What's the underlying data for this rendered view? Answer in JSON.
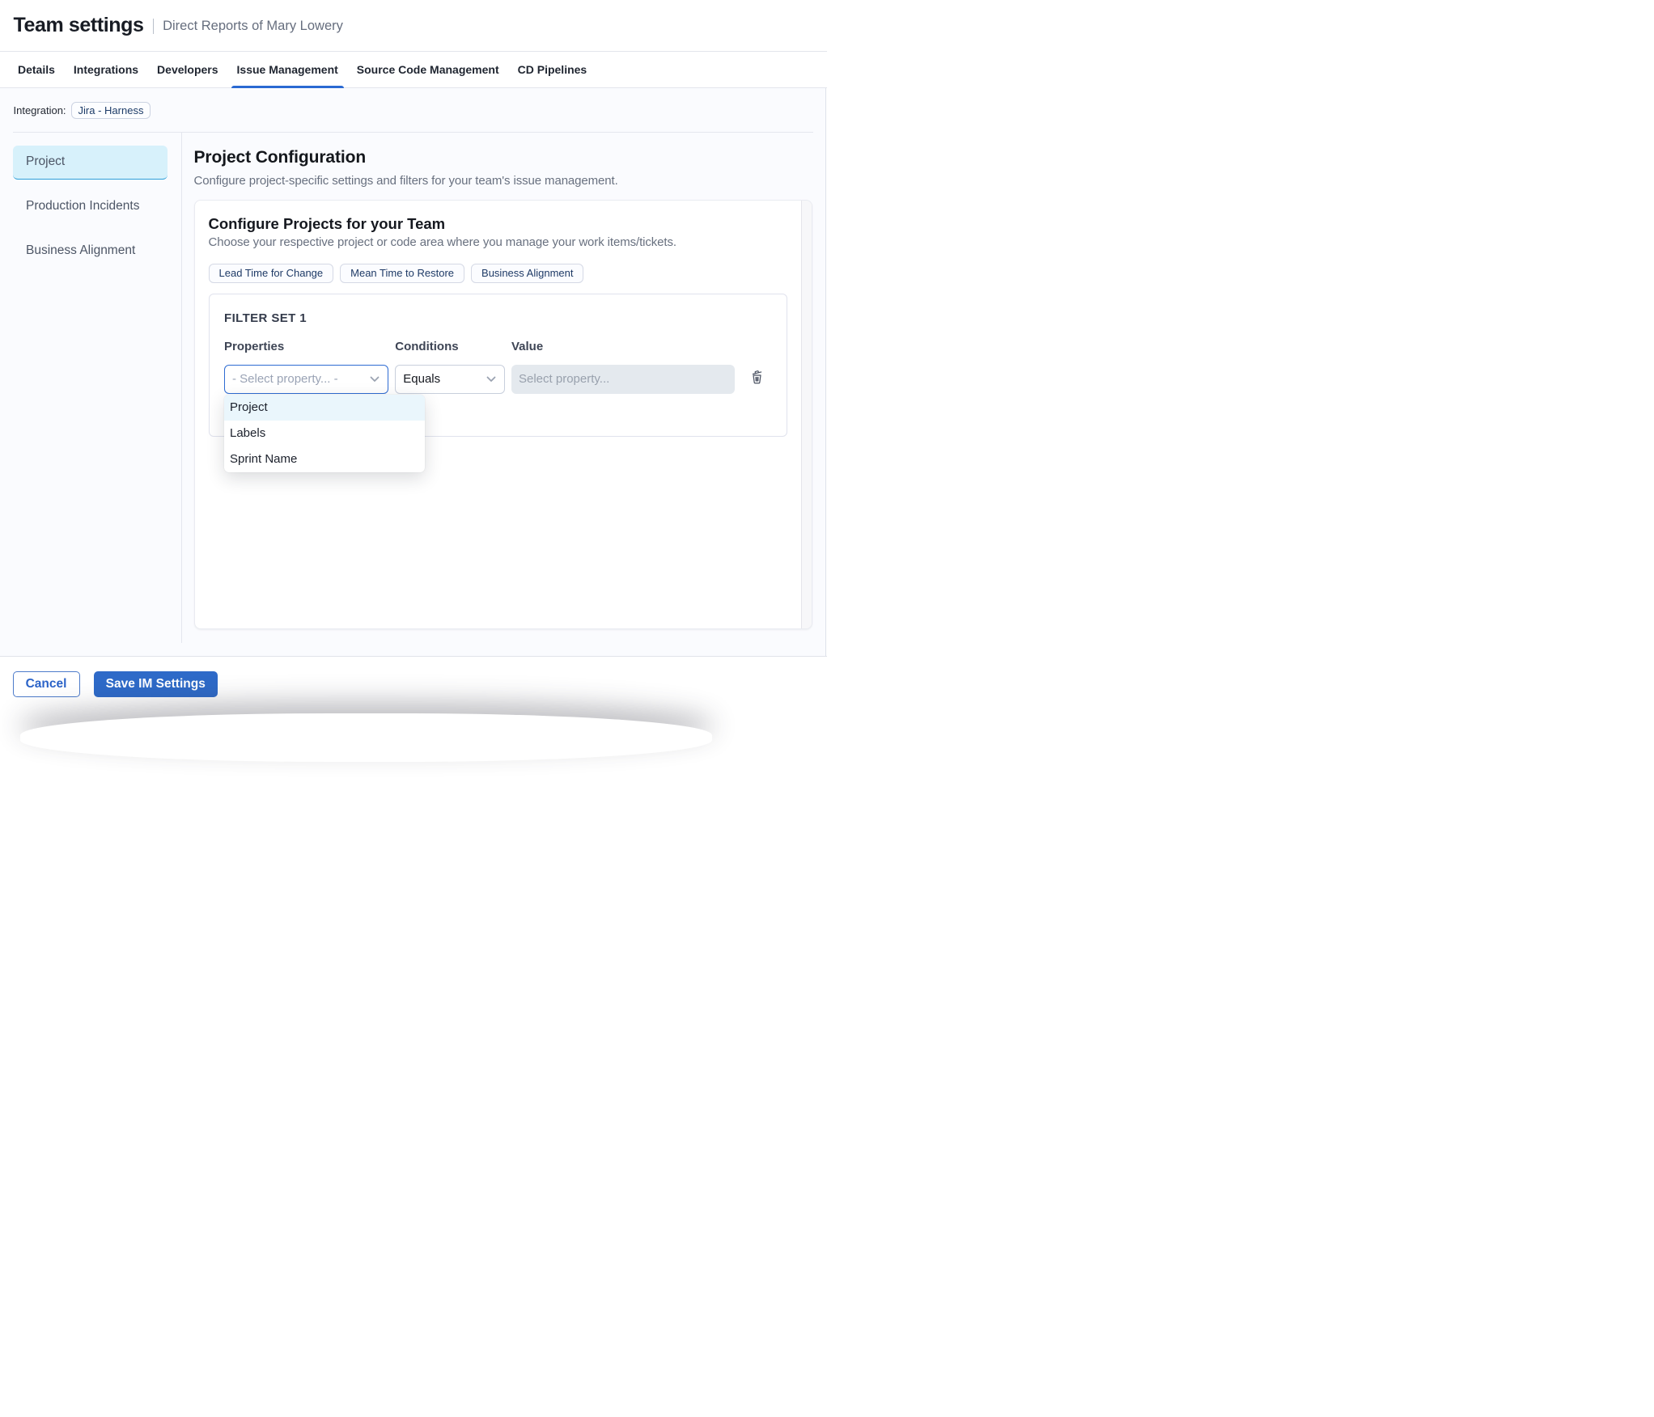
{
  "header": {
    "title": "Team settings",
    "subtitle": "Direct Reports of Mary Lowery"
  },
  "tabs": {
    "items": [
      {
        "label": "Details",
        "active": false
      },
      {
        "label": "Integrations",
        "active": false
      },
      {
        "label": "Developers",
        "active": false
      },
      {
        "label": "Issue Management",
        "active": true
      },
      {
        "label": "Source Code Management",
        "active": false
      },
      {
        "label": "CD Pipelines",
        "active": false
      }
    ]
  },
  "integration": {
    "label": "Integration:",
    "value": "Jira - Harness"
  },
  "sidebar": {
    "items": [
      {
        "label": "Project",
        "selected": true
      },
      {
        "label": "Production Incidents",
        "selected": false
      },
      {
        "label": "Business Alignment",
        "selected": false
      }
    ]
  },
  "main": {
    "heading": "Project Configuration",
    "description": "Configure project-specific settings and filters for your team's issue management.",
    "card": {
      "heading": "Configure Projects for your Team",
      "description": "Choose your respective project or code area where you manage your work items/tickets.",
      "chips": [
        {
          "label": "Lead Time for Change"
        },
        {
          "label": "Mean Time to Restore"
        },
        {
          "label": "Business Alignment"
        }
      ],
      "filter_set": {
        "title": "FILTER SET 1",
        "columns": {
          "properties": "Properties",
          "conditions": "Conditions",
          "value": "Value"
        },
        "property_placeholder": "- Select property... -",
        "condition_value": "Equals",
        "value_placeholder": "Select property..."
      },
      "dropdown": {
        "options": [
          {
            "label": "Project",
            "highlighted": true
          },
          {
            "label": "Labels",
            "highlighted": false
          },
          {
            "label": "Sprint Name",
            "highlighted": false
          }
        ]
      }
    }
  },
  "footer": {
    "cancel_label": "Cancel",
    "save_label": "Save IM Settings"
  },
  "colors": {
    "accent_blue": "#2e6ac8",
    "tab_underline": "#2a69d2",
    "selected_item_bg": "#d7f1fb",
    "selected_item_border": "#2d9fd9",
    "content_bg": "#fafbfe",
    "chip_text": "#1e3a66"
  }
}
